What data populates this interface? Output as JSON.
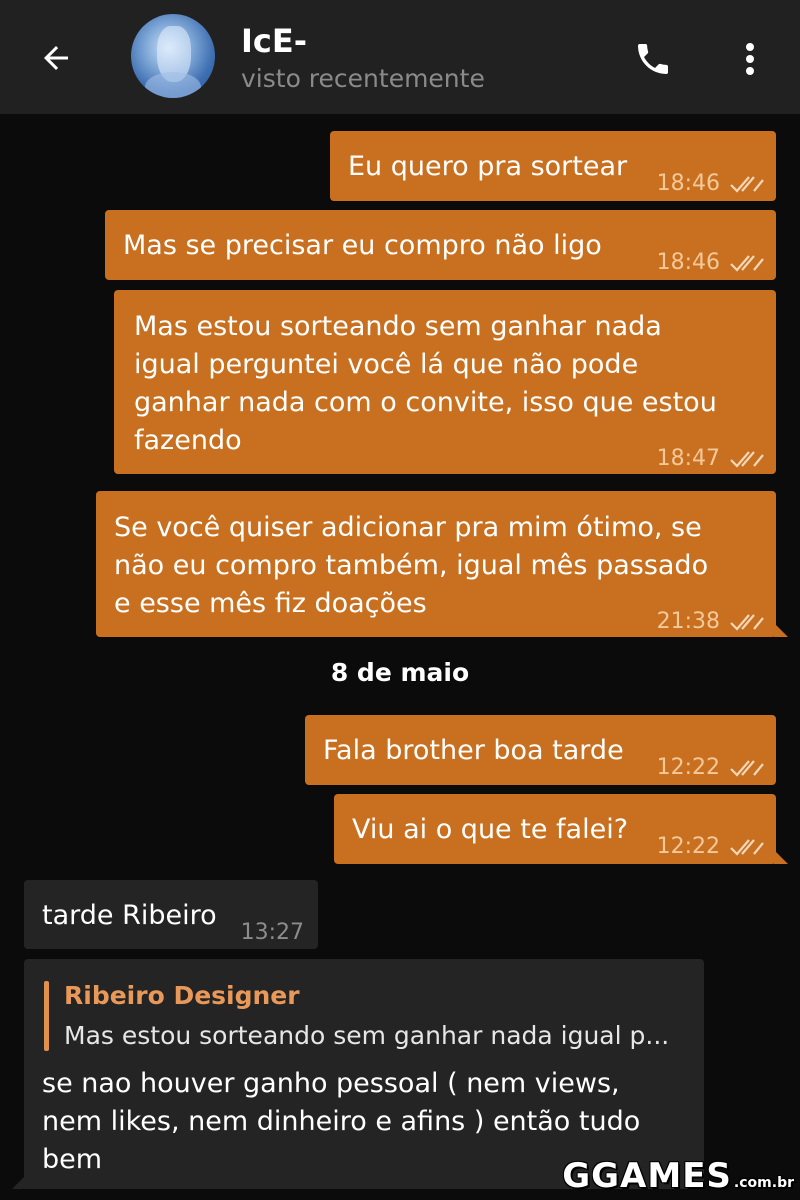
{
  "header": {
    "contact_name": "IcE-",
    "status": "visto recentemente",
    "icons": {
      "back": "arrow-left-icon",
      "call": "phone-icon",
      "menu": "more-vert-icon"
    }
  },
  "messages": [
    {
      "direction": "out",
      "text": "Eu quero pra sortear",
      "time": "18:46"
    },
    {
      "direction": "out",
      "text": "Mas se precisar eu compro não ligo",
      "time": "18:46"
    },
    {
      "direction": "out",
      "lines": [
        "Mas estou sorteando sem ganhar nada",
        "igual perguntei você lá que não pode",
        "ganhar nada com o convite, isso que estou",
        "fazendo"
      ],
      "time": "18:47"
    },
    {
      "direction": "out",
      "lines": [
        "Se você quiser adicionar pra mim ótimo, se",
        "não eu compro também, igual mês passado",
        "e esse mês fiz doações"
      ],
      "time": "21:38"
    }
  ],
  "date_separator": "8 de maio",
  "messages_day2": [
    {
      "direction": "out",
      "text": "Fala brother boa tarde",
      "time": "12:22"
    },
    {
      "direction": "out",
      "text": "Viu ai o que te falei?",
      "time": "12:22"
    },
    {
      "direction": "in",
      "text": "tarde Ribeiro",
      "time": "13:27"
    },
    {
      "direction": "in",
      "reply": {
        "author": "Ribeiro Designer",
        "text": "Mas estou sorteando sem ganhar nada igual p..."
      },
      "lines": [
        "se nao houver ganho pessoal ( nem views,",
        "nem likes, nem dinheiro  e afins ) então tudo",
        "bem"
      ]
    }
  ],
  "watermark": {
    "main": "GGAMES",
    "suffix": ".com.br"
  },
  "colors": {
    "outgoing": "#c8701f",
    "incoming": "#242424",
    "header": "#212121",
    "background": "#0b0b0b"
  }
}
